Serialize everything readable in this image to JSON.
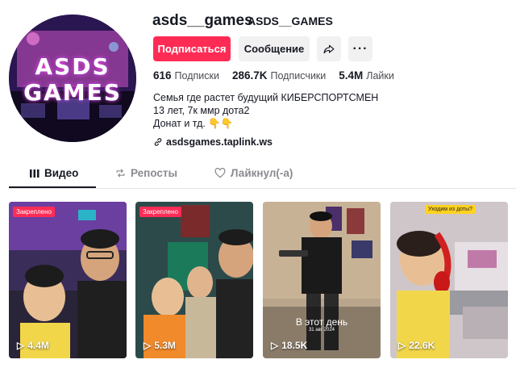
{
  "profile": {
    "username": "asds__games",
    "nickname": "ASDS__GAMES",
    "avatar_text_line1": "ASDS",
    "avatar_text_line2": "GAMES"
  },
  "actions": {
    "follow_label": "Подписаться",
    "message_label": "Сообщение",
    "share_icon": "share-icon",
    "more_label": "···"
  },
  "stats": {
    "following_count": "616",
    "following_label": "Подписки",
    "followers_count": "286.7K",
    "followers_label": "Подписчики",
    "likes_count": "5.4M",
    "likes_label": "Лайки"
  },
  "bio": {
    "line1": "Семья где растет будущий КИБЕРСПОРТСМЕН",
    "line2": "13 лет, 7к ммр дота2",
    "line3": "Донат и тд. 👇👇",
    "link": "asdsgames.taplink.ws"
  },
  "tabs": [
    {
      "label": "Видео",
      "icon": "grid-icon",
      "active": true
    },
    {
      "label": "Репосты",
      "icon": "repost-icon",
      "active": false
    },
    {
      "label": "Лайкнул(-а)",
      "icon": "liked-heart-icon",
      "active": false
    }
  ],
  "videos": [
    {
      "badge": "Закреплено",
      "views": "4.4M"
    },
    {
      "badge": "Закреплено",
      "views": "5.3M"
    },
    {
      "overlay_text": "В этот день",
      "overlay_date": "31 авг 2024",
      "views": "18.5K"
    },
    {
      "badge": "Уходим из доты?",
      "views": "22.6K"
    }
  ],
  "colors": {
    "accent": "#fe2c55",
    "button_gray": "#f1f1f2",
    "text": "#161823"
  }
}
